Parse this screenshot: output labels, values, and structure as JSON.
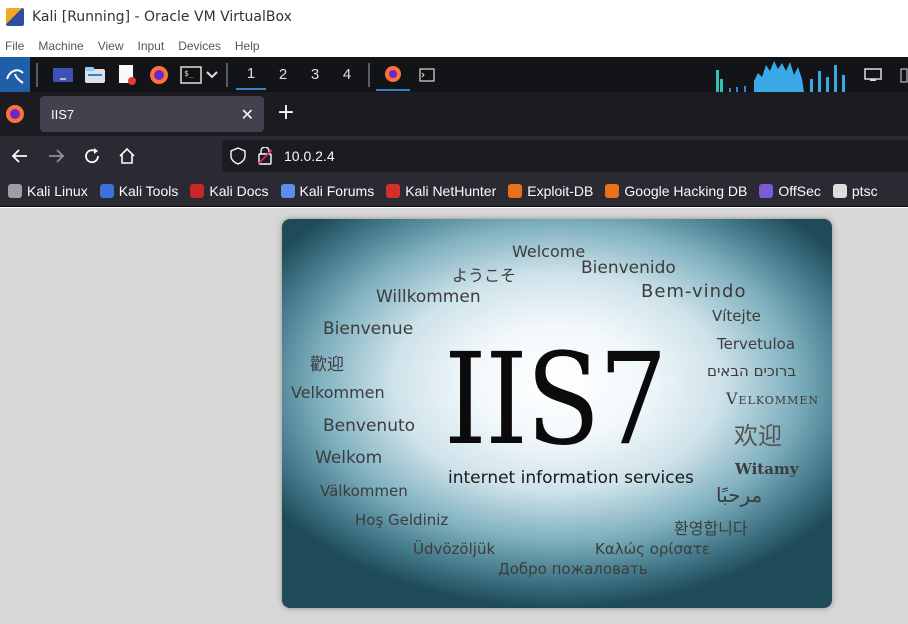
{
  "window": {
    "title": "Kali [Running] - Oracle VM VirtualBox"
  },
  "vbox_menu": [
    "File",
    "Machine",
    "View",
    "Input",
    "Devices",
    "Help"
  ],
  "panel": {
    "workspaces": [
      "1",
      "2",
      "3",
      "4"
    ],
    "active_workspace": "1"
  },
  "browser": {
    "tab_title": "IIS7",
    "new_tab": "+",
    "url": "10.0.2.4",
    "bookmarks": [
      {
        "label": "Kali Linux",
        "color": "#9aa0a6"
      },
      {
        "label": "Kali Tools",
        "color": "#3d72d9"
      },
      {
        "label": "Kali Docs",
        "color": "#c62828"
      },
      {
        "label": "Kali Forums",
        "color": "#5b8def"
      },
      {
        "label": "Kali NetHunter",
        "color": "#d32f2f"
      },
      {
        "label": "Exploit-DB",
        "color": "#e8711a"
      },
      {
        "label": "Google Hacking DB",
        "color": "#e8711a"
      },
      {
        "label": "OffSec",
        "color": "#7b5cd6"
      },
      {
        "label": "ptsc",
        "color": "#dddddd"
      }
    ]
  },
  "iis": {
    "logo": "IIS7",
    "subtitle": "internet information services",
    "welcome_words": {
      "en": "Welcome",
      "ja": "ようこそ",
      "es": "Bienvenido",
      "de": "Willkommen",
      "pt": "Bem-vindo",
      "cs": "Vítejte",
      "fr": "Bienvenue",
      "et": "Tervetuloa",
      "zh_tw": "歡迎",
      "he": "ברוכים הבאים",
      "da": "Velkommen",
      "no": "Velkommen",
      "it": "Benvenuto",
      "zh_cn": "欢迎",
      "nl": "Welkom",
      "pl": "Witamy",
      "sv": "Välkommen",
      "ar": "مرحبًا",
      "tr": "Hoş Geldiniz",
      "ko": "환영합니다",
      "hu": "Üdvözöljük",
      "el": "Καλώς ορίσατε",
      "ru": "Добро пожаловать"
    }
  }
}
